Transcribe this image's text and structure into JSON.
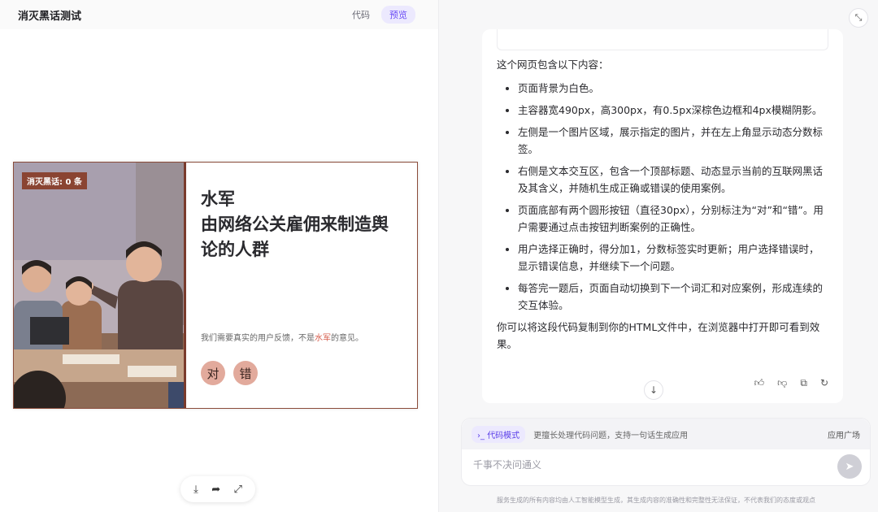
{
  "left": {
    "app_title": "消灭黑话测试",
    "tabs": [
      {
        "label": "代码"
      },
      {
        "label": "预览"
      }
    ],
    "card": {
      "score_badge": "消灭黑话: 0 条",
      "term": "水军",
      "meaning": "由网络公关雇佣来制造舆论的人群",
      "example_before": "我们需要真实的用户反馈，不是",
      "example_highlight": "水军",
      "example_after": "的意见。",
      "buttons": {
        "right": "对",
        "wrong": "错"
      }
    },
    "tools": {
      "download_icon": "download-icon",
      "share_icon": "share-icon",
      "fullscreen_icon": "expand-icon"
    }
  },
  "right": {
    "intro": "这个网页包含以下内容：",
    "points": [
      "页面背景为白色。",
      "主容器宽490px，高300px，有0.5px深棕色边框和4px模糊阴影。",
      "左侧是一个图片区域，展示指定的图片，并在左上角显示动态分数标签。",
      "右侧是文本交互区，包含一个顶部标题、动态显示当前的互联网黑话及其含义，并随机生成正确或错误的使用案例。",
      "页面底部有两个圆形按钮（直径30px），分别标注为“对”和“错”。用户需要通过点击按钮判断案例的正确性。",
      "用户选择正确时，得分加1，分数标签实时更新；用户选择错误时，显示错误信息，并继续下一个问题。",
      "每答完一题后，页面自动切换到下一个词汇和对应案例，形成连续的交互体验。"
    ],
    "outro": "你可以将这段代码复制到你的HTML文件中，在浏览器中打开即可看到效果。",
    "composer": {
      "mode_label": "代码模式",
      "mode_desc": "更擅长处理代码问题，支持一句话生成应用",
      "app_store": "应用广场",
      "placeholder": "千事不决问通义"
    },
    "disclaimer": "服务生成的所有内容均由人工智能模型生成，其生成内容的准确性和完整性无法保证，不代表我们的态度或观点"
  }
}
